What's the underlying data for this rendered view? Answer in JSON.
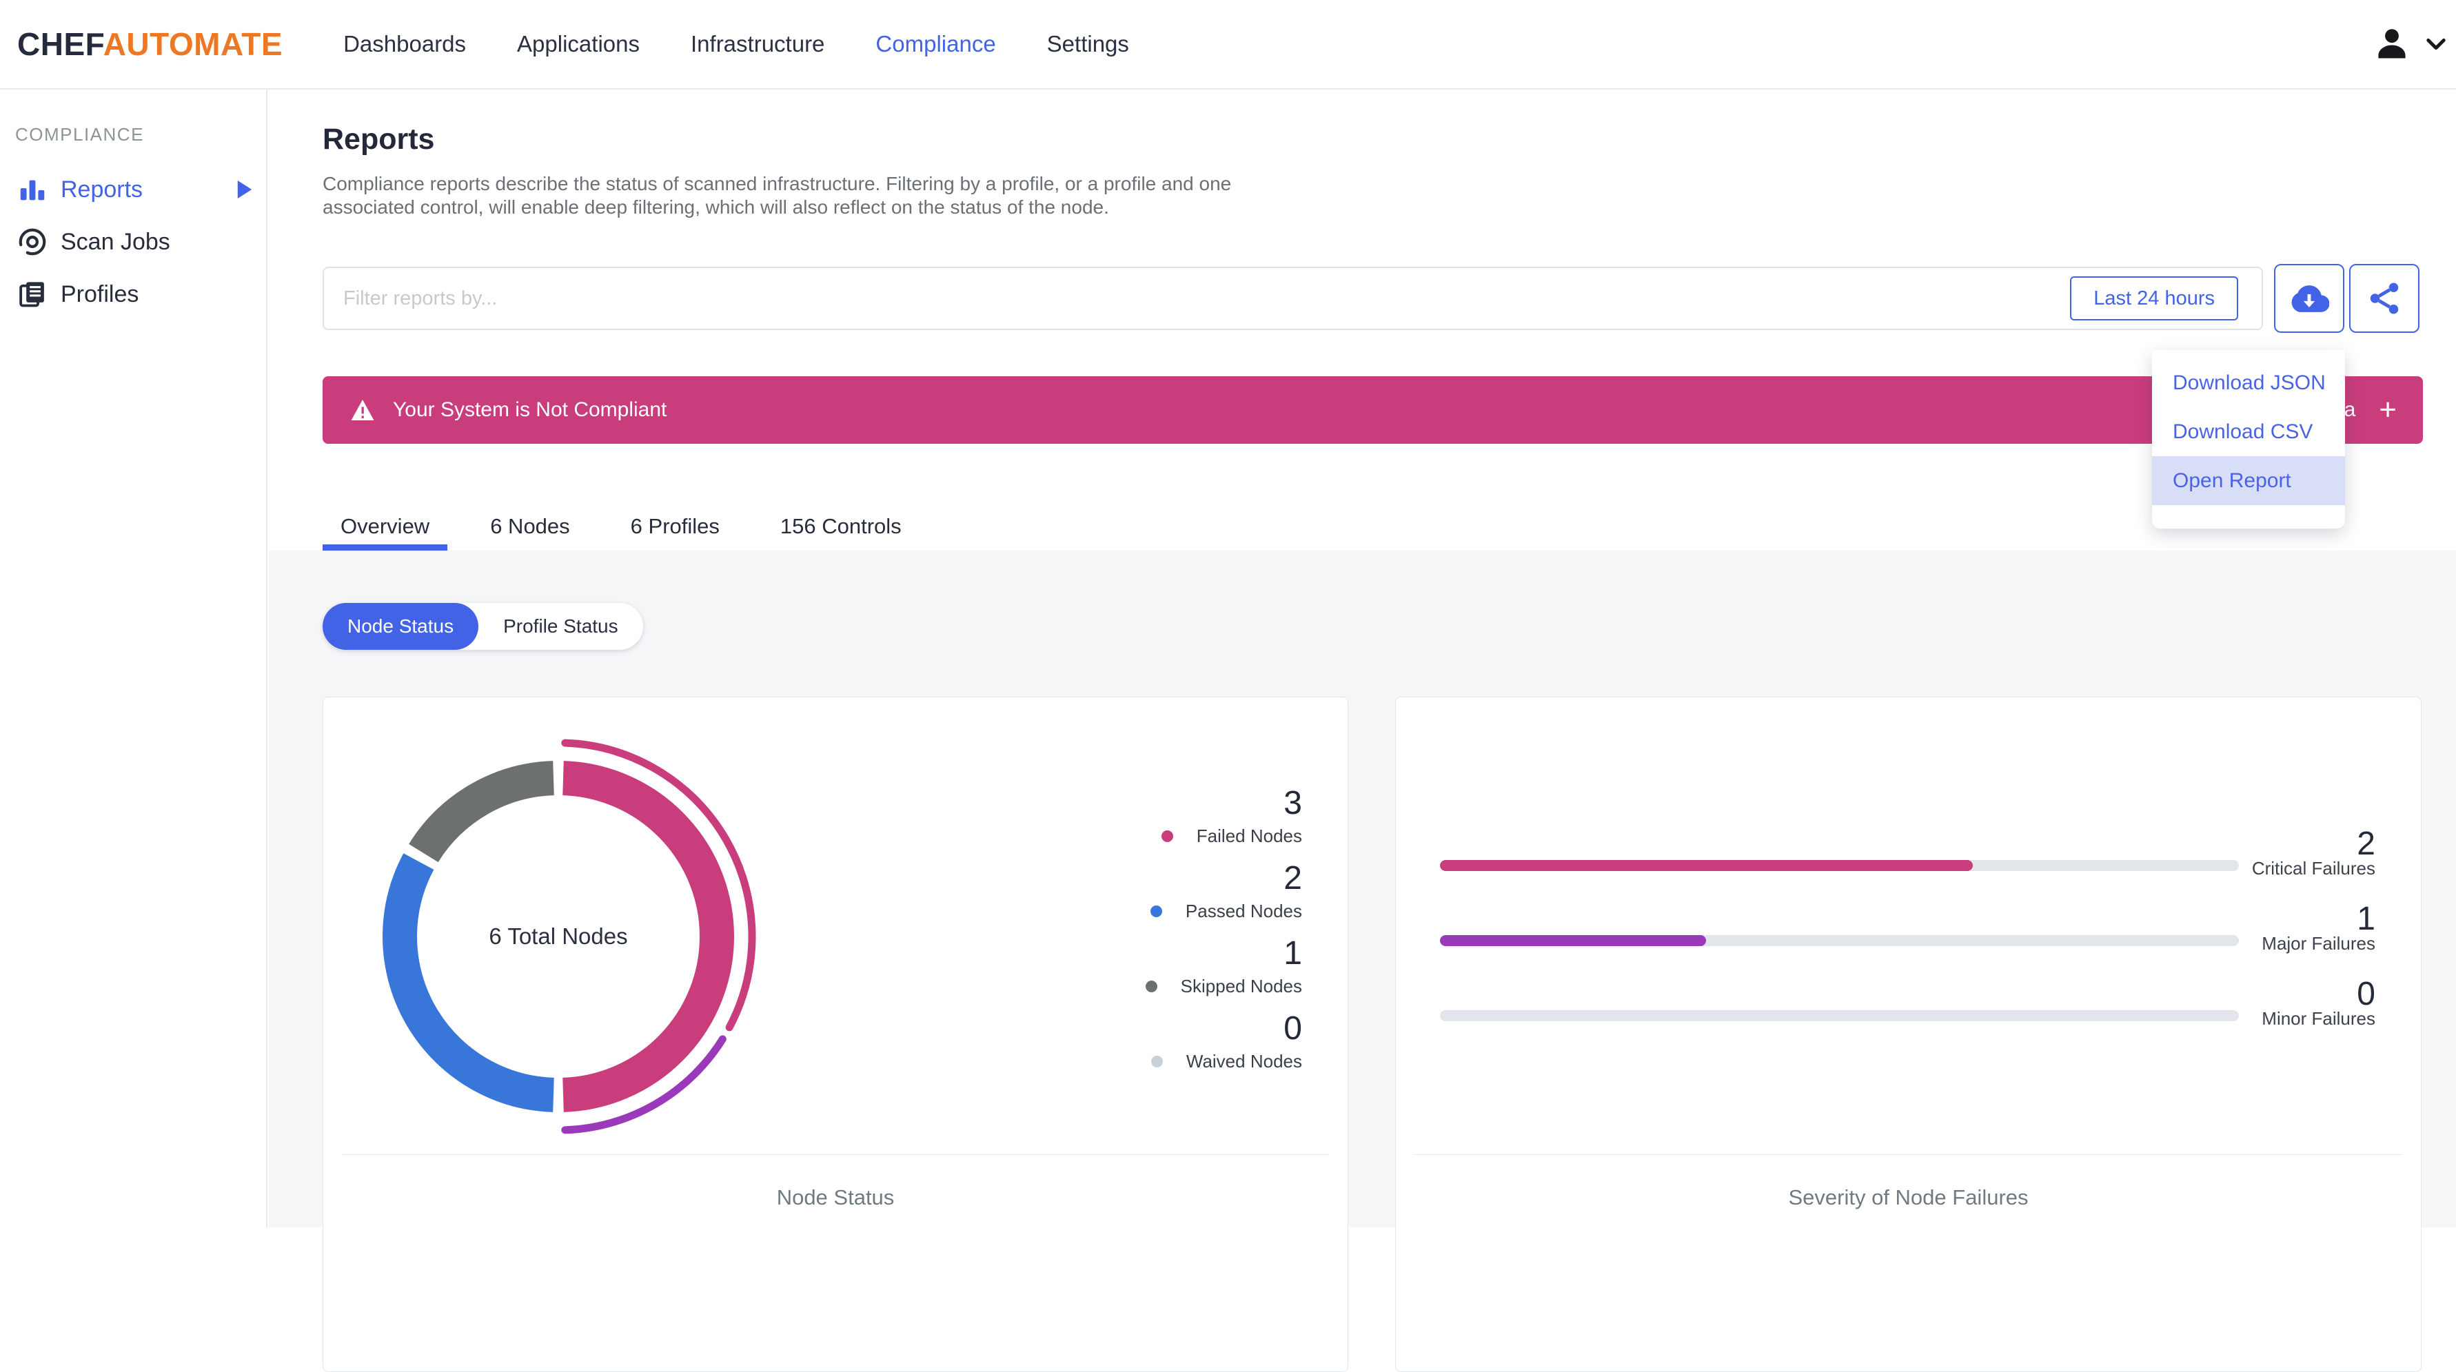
{
  "brand": {
    "chef": "CHEF",
    "automate": "AUTOMATE"
  },
  "header": {
    "nav": [
      {
        "label": "Dashboards",
        "active": false
      },
      {
        "label": "Applications",
        "active": false
      },
      {
        "label": "Infrastructure",
        "active": false
      },
      {
        "label": "Compliance",
        "active": true
      },
      {
        "label": "Settings",
        "active": false
      }
    ]
  },
  "sidebar": {
    "section": "COMPLIANCE",
    "items": [
      {
        "label": "Reports",
        "icon": "bar-chart-icon",
        "active": true,
        "has_arrow": true
      },
      {
        "label": "Scan Jobs",
        "icon": "scan-icon",
        "active": false,
        "has_arrow": false
      },
      {
        "label": "Profiles",
        "icon": "profiles-icon",
        "active": false,
        "has_arrow": false
      }
    ]
  },
  "page": {
    "title": "Reports",
    "description": "Compliance reports describe the status of scanned infrastructure. Filtering by a profile, or a profile and one associated control, will enable deep filtering, which will also reflect on the status of the node."
  },
  "filter": {
    "placeholder": "Filter reports by...",
    "time_range_label": "Last 24 hours"
  },
  "banner": {
    "text": "Your System is Not Compliant",
    "partial_right_text": "ta",
    "plus_label": "+"
  },
  "download_menu": {
    "items": [
      {
        "label": "Download JSON",
        "highlighted": false
      },
      {
        "label": "Download CSV",
        "highlighted": false
      },
      {
        "label": "Open Report",
        "highlighted": true
      }
    ]
  },
  "tabs": [
    {
      "label": "Overview",
      "active": true
    },
    {
      "label": "6 Nodes",
      "active": false
    },
    {
      "label": "6 Profiles",
      "active": false
    },
    {
      "label": "156 Controls",
      "active": false
    }
  ],
  "status_toggle": {
    "options": [
      {
        "label": "Node Status",
        "selected": true
      },
      {
        "label": "Profile Status",
        "selected": false
      }
    ]
  },
  "chart_data": [
    {
      "type": "donut",
      "title": "Node Status",
      "center_label": "6 Total Nodes",
      "total": 6,
      "segments": [
        {
          "label": "Failed Nodes",
          "value": 3,
          "color": "#C93D7C"
        },
        {
          "label": "Passed Nodes",
          "value": 2,
          "color": "#3877D9"
        },
        {
          "label": "Skipped Nodes",
          "value": 1,
          "color": "#6C7071"
        },
        {
          "label": "Waived Nodes",
          "value": 0,
          "color": "#C9D0D6"
        }
      ],
      "overlay_segments": [
        {
          "label": "Critical",
          "value": 2,
          "color": "#C93D7C"
        },
        {
          "label": "Major",
          "value": 1,
          "color": "#9A3ABB"
        },
        {
          "label": "Minor",
          "value": 0,
          "color": "#E2E5E9"
        }
      ]
    },
    {
      "type": "bar",
      "title": "Severity of Node Failures",
      "bars": [
        {
          "label": "Critical Failures",
          "value": 2,
          "color": "#C93D7C"
        },
        {
          "label": "Major Failures",
          "value": 1,
          "color": "#9A3ABB"
        },
        {
          "label": "Minor Failures",
          "value": 0,
          "color": "#E2E5E9"
        }
      ],
      "bar_max": 3
    }
  ],
  "colors": {
    "accent_blue": "#4363E6",
    "banner_pink": "#C93D7C",
    "brand_orange": "#EE7724",
    "menu_highlight": "#D8DDF8",
    "content_background": "#F4F6F8"
  }
}
